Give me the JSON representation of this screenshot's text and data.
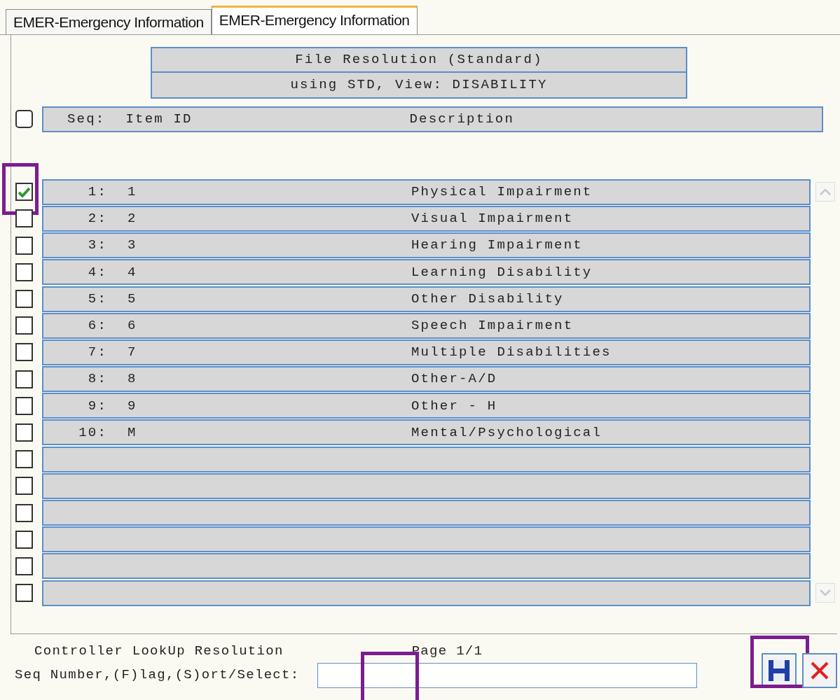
{
  "tabs": [
    {
      "label": "EMER-Emergency Information",
      "selected": false
    },
    {
      "label": "EMER-Emergency Information",
      "selected": true
    }
  ],
  "titles": [
    "File Resolution (Standard)",
    "using STD, View: DISABILITY"
  ],
  "header": {
    "checked": false,
    "seq": "Seq:",
    "item_id": "Item ID",
    "description": "Description"
  },
  "rows": [
    {
      "seq": "1:",
      "item_id": "1",
      "description": "Physical Impairment",
      "checked": true,
      "highlighted": true
    },
    {
      "seq": "2:",
      "item_id": "2",
      "description": "Visual Impairment",
      "checked": false,
      "highlighted": false
    },
    {
      "seq": "3:",
      "item_id": "3",
      "description": "Hearing Impairment",
      "checked": false,
      "highlighted": false
    },
    {
      "seq": "4:",
      "item_id": "4",
      "description": "Learning Disability",
      "checked": false,
      "highlighted": false
    },
    {
      "seq": "5:",
      "item_id": "5",
      "description": "Other Disability",
      "checked": false,
      "highlighted": false
    },
    {
      "seq": "6:",
      "item_id": "6",
      "description": "Speech Impairment",
      "checked": false,
      "highlighted": false
    },
    {
      "seq": "7:",
      "item_id": "7",
      "description": "Multiple Disabilities",
      "checked": false,
      "highlighted": false
    },
    {
      "seq": "8:",
      "item_id": "8",
      "description": "Other-A/D",
      "checked": false,
      "highlighted": false
    },
    {
      "seq": "9:",
      "item_id": "9",
      "description": "Other - H",
      "checked": false,
      "highlighted": false
    },
    {
      "seq": "10:",
      "item_id": "M",
      "description": "Mental/Psychological",
      "checked": false,
      "highlighted": false
    },
    {
      "checked": false,
      "highlighted": false
    },
    {
      "checked": false,
      "highlighted": false
    },
    {
      "checked": false,
      "highlighted": false
    },
    {
      "checked": false,
      "highlighted": false
    },
    {
      "checked": false,
      "highlighted": false
    },
    {
      "checked": false,
      "highlighted": false
    }
  ],
  "footer": {
    "caption": "Controller LookUp Resolution",
    "page": "Page 1/1",
    "prompt": "Seq Number,(F)lag,(S)ort/Select:",
    "input_highlighted": true,
    "save_highlighted": true
  }
}
